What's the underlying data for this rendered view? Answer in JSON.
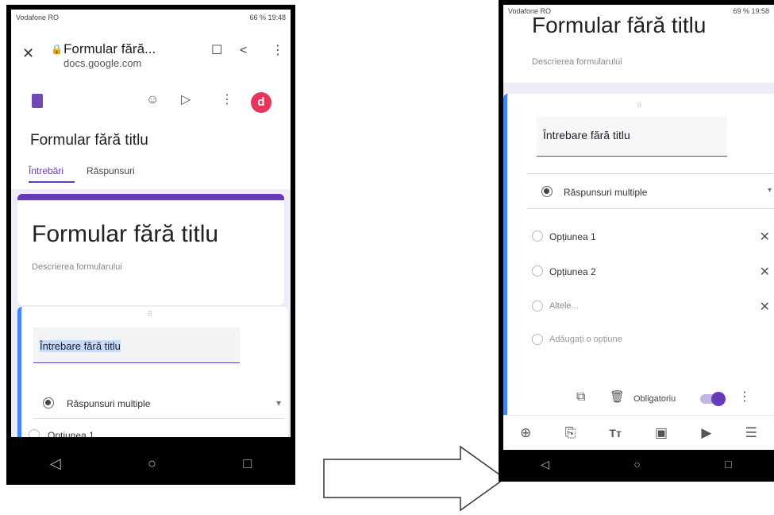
{
  "left_phone": {
    "status": {
      "carrier": "Vodafone RO",
      "right": "66 % 19:48"
    },
    "browser": {
      "page_title": "Formular fără...",
      "url": "docs.google.com"
    },
    "toolbar": {
      "avatar_letter": "d"
    },
    "form_title_small": "Formular fără titlu",
    "tabs": [
      {
        "label": "Întrebări"
      },
      {
        "label": "Răspunsuri"
      }
    ],
    "form_title_large": "Formular fără titlu",
    "form_description": "Descrierea formularului",
    "question_title": "Întrebare fără titlu",
    "question_type": "Răspunsuri multiple",
    "option1": "Opțiunea 1"
  },
  "right_phone": {
    "status": {
      "carrier": "Vodafone RO",
      "right": "69 % 19:58"
    },
    "form_title_partial": "Formular fără titlu",
    "form_description": "Descrierea formularului",
    "question_title": "Întrebare fără titlu",
    "question_type": "Răspunsuri multiple",
    "options": [
      {
        "label": "Opțiunea 1"
      },
      {
        "label": "Opțiunea 2"
      },
      {
        "label": "Altele..."
      }
    ],
    "add_option": "Adăugați o opțiune",
    "required_label": "Obligatoriu",
    "bottom_tools": [
      {
        "icon": "add-circle-icon"
      },
      {
        "icon": "import-icon"
      },
      {
        "icon": "text-icon"
      },
      {
        "icon": "image-icon"
      },
      {
        "icon": "video-icon"
      },
      {
        "icon": "section-icon"
      }
    ]
  },
  "colors": {
    "purple": "#673ab7",
    "blue_bar": "#4285f4",
    "avatar": "#e8335a",
    "docs_icon": "#7248b9"
  }
}
